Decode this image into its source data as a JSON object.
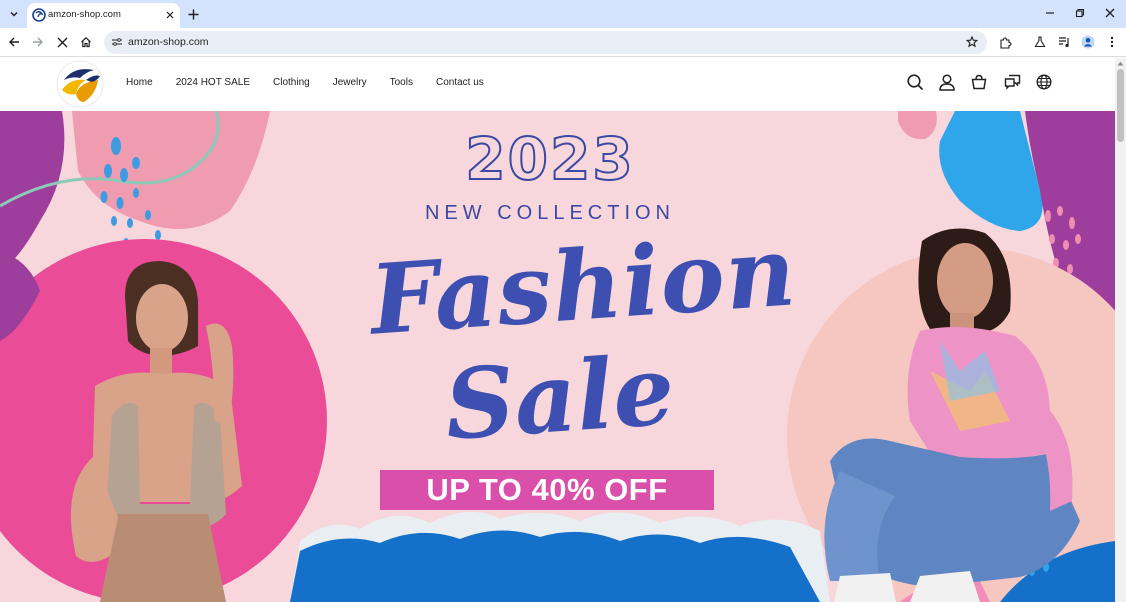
{
  "browser": {
    "tab": {
      "title": "amzon-shop.com"
    },
    "address_bar": {
      "url": "amzon-shop.com"
    }
  },
  "site": {
    "nav": [
      {
        "label": "Home"
      },
      {
        "label": "2024 HOT SALE"
      },
      {
        "label": "Clothing"
      },
      {
        "label": "Jewelry"
      },
      {
        "label": "Tools"
      },
      {
        "label": "Contact us"
      }
    ],
    "header_icons": [
      "search-icon",
      "account-icon",
      "cart-icon",
      "chat-icon",
      "globe-icon"
    ]
  },
  "hero": {
    "year": "2023",
    "collection": "NEW COLLECTION",
    "headline_1": "Fashion",
    "headline_2": "Sale",
    "offer": "UP TO 40% OFF"
  },
  "colors": {
    "tabstrip": "#d3e3fd",
    "hero_background": "#f7d6dc",
    "headline": "#3d4fb0",
    "offer_band": "#d94fa9",
    "wave": "#1570c9"
  }
}
